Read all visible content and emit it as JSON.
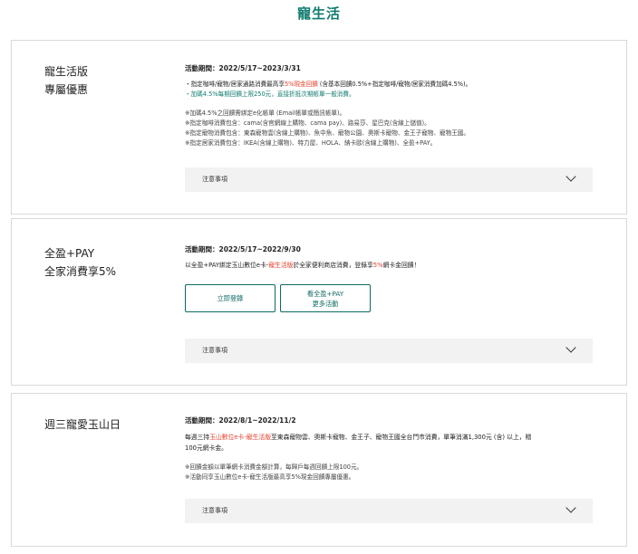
{
  "page_title": "寵生活",
  "cards": [
    {
      "heading_lines": [
        "寵生活版",
        "專屬優惠"
      ],
      "period": "活動期間：2022/5/17~2023/3/31",
      "bullets": [
        {
          "pre": "・指定咖啡/寵物/居家通路消費最高享",
          "hl": "5%現金回饋",
          "post": " (含基本回饋0.5%+指定咖啡/寵物/居家消費加碼4.5%)。"
        },
        {
          "text": "・加碼4.5%每期回饋上限250元，直接折抵次期帳單一般消費。"
        }
      ],
      "notes": [
        "※加碼4.5%之回饋需綁定e化帳單 (Email帳單或簡訊帳單)。",
        "※指定咖啡消費包含：cama(含官網線上購物、cama pay)、路易莎、星巴克(含線上儲值)。",
        "※指定寵物消費包含：東森寵物雲(含線上購物)、魚中魚、寵物公園、奧斯卡寵物、金王子寵物、寵物王國。",
        "※指定居家消費包含：IKEA(含線上購物)、特力屋、HOLA、納卡歐(含線上購物)、全盈+PAY。"
      ],
      "accordion_label": "注意事項"
    },
    {
      "heading_lines": [
        "全盈+PAY",
        "全家消費享5%"
      ],
      "period": "活動期間：2022/5/17~2022/9/30",
      "body": {
        "pre": "以全盈+PAY綁定玉山數位e卡-",
        "hl1": "寵生活版",
        "mid": "於全家便利商店消費，登錄享",
        "hl2": "5%",
        "post": "網卡金回饋！"
      },
      "buttons": [
        {
          "label": "立即登錄"
        },
        {
          "label_lines": [
            "看全盈+PAY",
            "更多活動"
          ]
        }
      ],
      "accordion_label": "注意事項"
    },
    {
      "heading_lines": [
        "週三寵愛玉山日"
      ],
      "period": "活動期間：2022/8/1~2022/11/2",
      "body": {
        "pre": "每週三持",
        "hl": "玉山數位e卡-寵生活版",
        "post": "至東森寵物雲、奧斯卡寵物、金王子、寵物王國全台門市消費，單筆消滿1,300元 (含) 以上，贈",
        "line2": "100元網卡金。"
      },
      "notes": [
        "※回饋金額以單筆網卡消費金額計算，每歸戶每週回饋上限100元。",
        "※活動同享玉山數位e卡-寵生活版最高享5%現金回饋專屬優惠。"
      ],
      "accordion_label": "注意事項"
    }
  ]
}
